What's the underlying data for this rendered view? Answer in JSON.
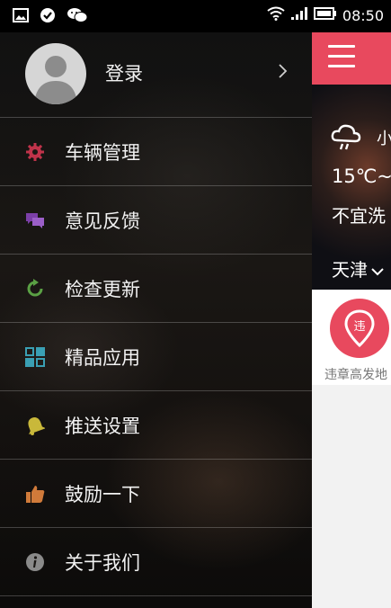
{
  "status_bar": {
    "time": "08:50",
    "icons": [
      "gallery-icon",
      "check-circle-icon",
      "wechat-icon",
      "wifi-icon",
      "signal-icon",
      "battery-icon"
    ]
  },
  "drawer": {
    "login_label": "登录",
    "menu_items": [
      {
        "label": "车辆管理",
        "icon": "gear-icon",
        "color": "#c0334a"
      },
      {
        "label": "意见反馈",
        "icon": "chat-bubbles-icon",
        "color": "#7b3fa8"
      },
      {
        "label": "检查更新",
        "icon": "refresh-icon",
        "color": "#5aa044"
      },
      {
        "label": "精品应用",
        "icon": "app-grid-icon",
        "color": "#3aa0b4"
      },
      {
        "label": "推送设置",
        "icon": "bell-icon",
        "color": "#c9b83a"
      },
      {
        "label": "鼓励一下",
        "icon": "thumbs-up-icon",
        "color": "#d07a3a"
      },
      {
        "label": "关于我们",
        "icon": "info-icon",
        "color": "#8a8a8a"
      }
    ]
  },
  "content": {
    "accent_color": "#e8495e",
    "weather": {
      "condition_partial": "小",
      "temperature_partial": "15℃~",
      "advice_partial": "不宜洗",
      "city": "天津"
    },
    "tile": {
      "icon_char": "违",
      "label_partial": "违章高发地"
    }
  }
}
